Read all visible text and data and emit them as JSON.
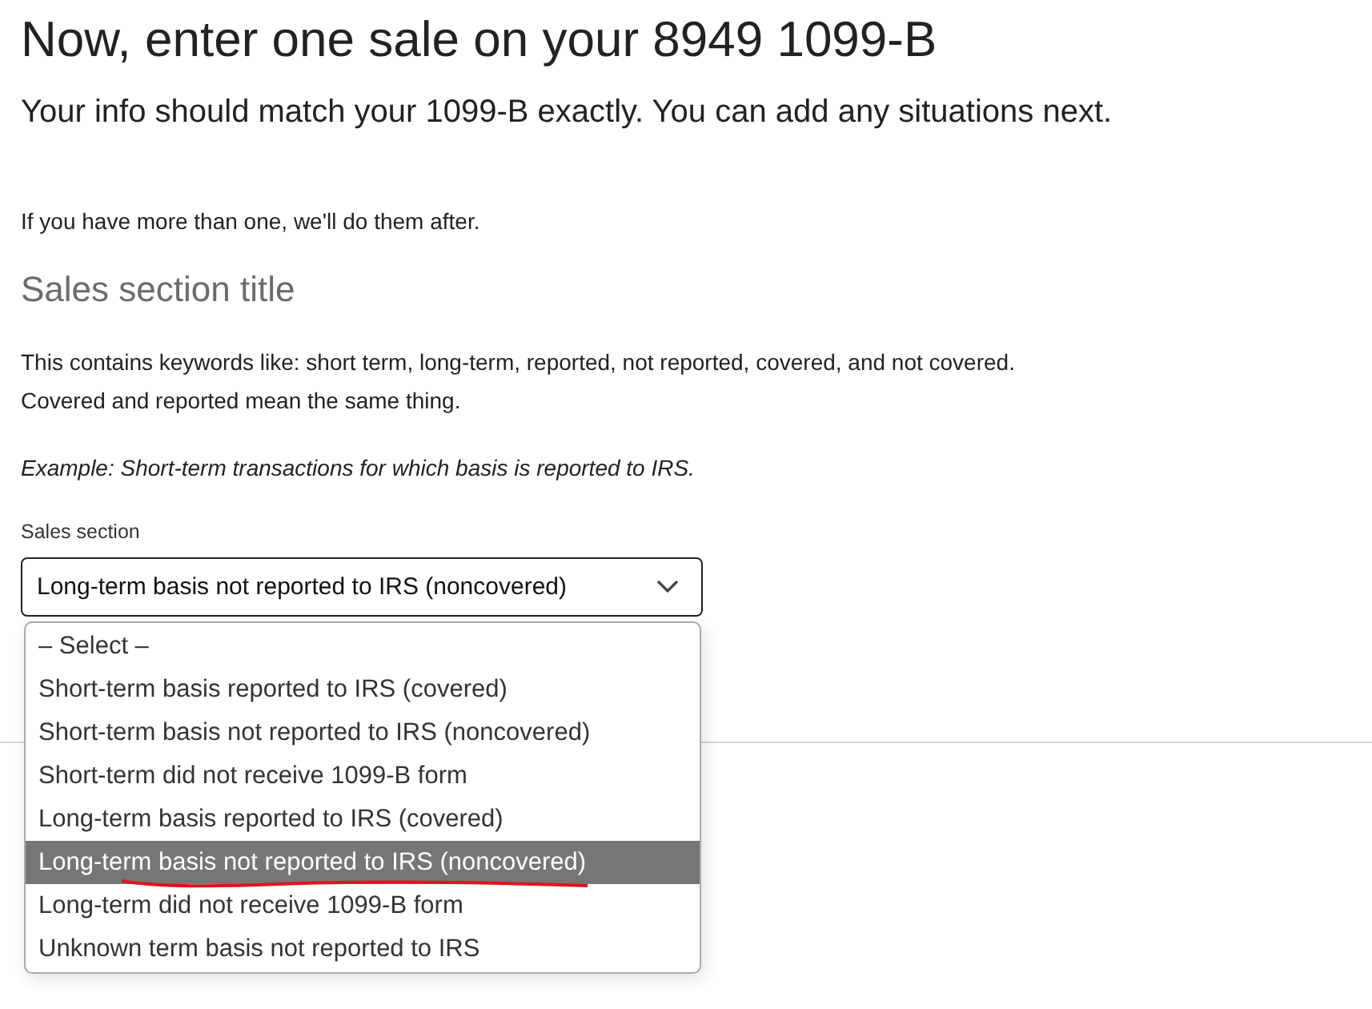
{
  "title": "Now, enter one sale on your 8949 1099-B",
  "subtitle": "Your info should match your 1099-B exactly. You can add any situations next.",
  "note": "If you have more than one, we'll do them after.",
  "section_title": "Sales section title",
  "description": [
    "This contains keywords like: short term, long-term, reported, not reported, covered, and not covered.",
    "Covered and reported mean the same thing."
  ],
  "example": "Example: Short-term transactions for which basis is reported to IRS.",
  "select": {
    "label": "Sales section",
    "value": "Long-term basis not reported to IRS (noncovered)",
    "expanded": true,
    "options": [
      {
        "label": "– Select –",
        "selected": false
      },
      {
        "label": "Short-term basis reported to IRS (covered)",
        "selected": false
      },
      {
        "label": "Short-term basis not reported to IRS (noncovered)",
        "selected": false
      },
      {
        "label": "Short-term did not receive 1099-B form",
        "selected": false
      },
      {
        "label": "Long-term basis reported to IRS (covered)",
        "selected": false
      },
      {
        "label": "Long-term basis not reported to IRS (noncovered)",
        "selected": true
      },
      {
        "label": "Long-term did not receive 1099-B form",
        "selected": false
      },
      {
        "label": "Unknown term basis not reported to IRS",
        "selected": false
      }
    ]
  }
}
